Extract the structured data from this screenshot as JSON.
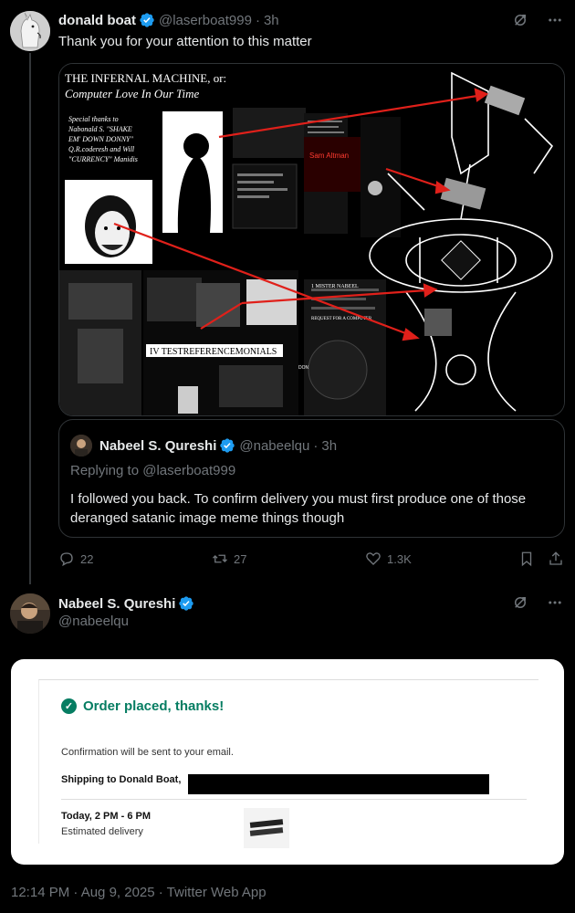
{
  "tweet1": {
    "author_name": "donald boat",
    "author_handle": "@laserboat999",
    "separator": "·",
    "time": "3h",
    "text": "Thank you for your attention to this matter",
    "media": {
      "title_line1": "THE INFERNAL MACHINE, or:",
      "title_line2": "Computer Love In Our Time",
      "thanks_line1": "Special thanks to",
      "thanks_line2": "Nabonald S. \"SHAKE",
      "thanks_line3": "EM' DOWN DONNY\"",
      "thanks_line4": "Q.R.coderesh and Will",
      "thanks_line5": "\"CURRENCY\" Manidis",
      "collage_label": "IV TESTREFERENCEMONIALS",
      "note_label_1": "1 MISTER NABEEL",
      "note_label_2": "REQUEST FOR A COMPUTER",
      "sam_label": "Sam Altman",
      "donald_label": "DONALD BOAT"
    },
    "quote": {
      "name": "Nabeel S. Qureshi",
      "handle": "@nabeelqu",
      "separator": "·",
      "time": "3h",
      "replying": "Replying to @laserboat999",
      "text": "I followed you back. To confirm delivery you must first produce one of those deranged satanic image meme things though"
    },
    "actions": {
      "replies": "22",
      "reposts": "27",
      "likes": "1.3K"
    }
  },
  "tweet2": {
    "author_name": "Nabeel S. Qureshi",
    "author_handle": "@nabeelqu",
    "order": {
      "title": "Order placed, thanks!",
      "confirmation": "Confirmation will be sent to your email.",
      "shipping": "Shipping to Donald Boat,",
      "delivery_time": "Today, 2 PM - 6 PM",
      "delivery_label": "Estimated delivery"
    },
    "footer": "12:14 PM · Aug 9, 2025 · Twitter Web App"
  },
  "colors": {
    "background": "#000000",
    "text": "#e7e9ea",
    "muted": "#71767b",
    "border": "#2f3336",
    "verified": "#1d9bf0",
    "order_green": "#067d62",
    "arrow_red": "#e0201a"
  },
  "icons": [
    "grok-icon",
    "more-icon",
    "reply-icon",
    "repost-icon",
    "like-icon",
    "bookmark-icon",
    "share-icon",
    "verified-icon",
    "check-icon"
  ]
}
